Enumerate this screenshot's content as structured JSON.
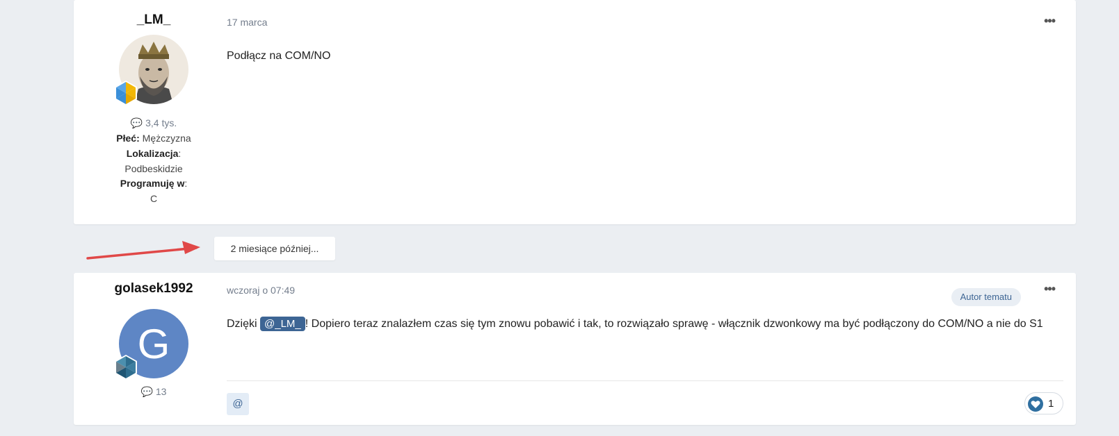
{
  "posts": [
    {
      "author": "_LM_",
      "post_count": "3,4 tys.",
      "fields": [
        {
          "label": "Płeć:",
          "value": "Mężczyzna"
        },
        {
          "label": "Lokalizacja",
          "value": "Podbeskidzie"
        },
        {
          "label": "Programuję w",
          "value": "C"
        }
      ],
      "date": "17 marca",
      "body": "Podłącz na COM/NO"
    },
    {
      "author": "golasek1992",
      "avatar_letter": "G",
      "post_count": "13",
      "date": "wczoraj o 07:49",
      "author_badge": "Autor tematu",
      "body_before": "Dzięki ",
      "mention": "@_LM_",
      "body_after": "! Dopiero teraz znalazłem czas się tym znowu pobawić i tak, to rozwiązało sprawę - włącznik dzwonkowy ma być podłączony do COM/NO a nie do S1",
      "quote_button": "@",
      "reaction_count": "1"
    }
  ],
  "time_gap": "2 miesiące później...",
  "more_icon": "•••",
  "colors": {
    "background": "#ebeef2",
    "accent": "#3d6594",
    "arrow": "#e04848",
    "muted": "#737d8c"
  }
}
